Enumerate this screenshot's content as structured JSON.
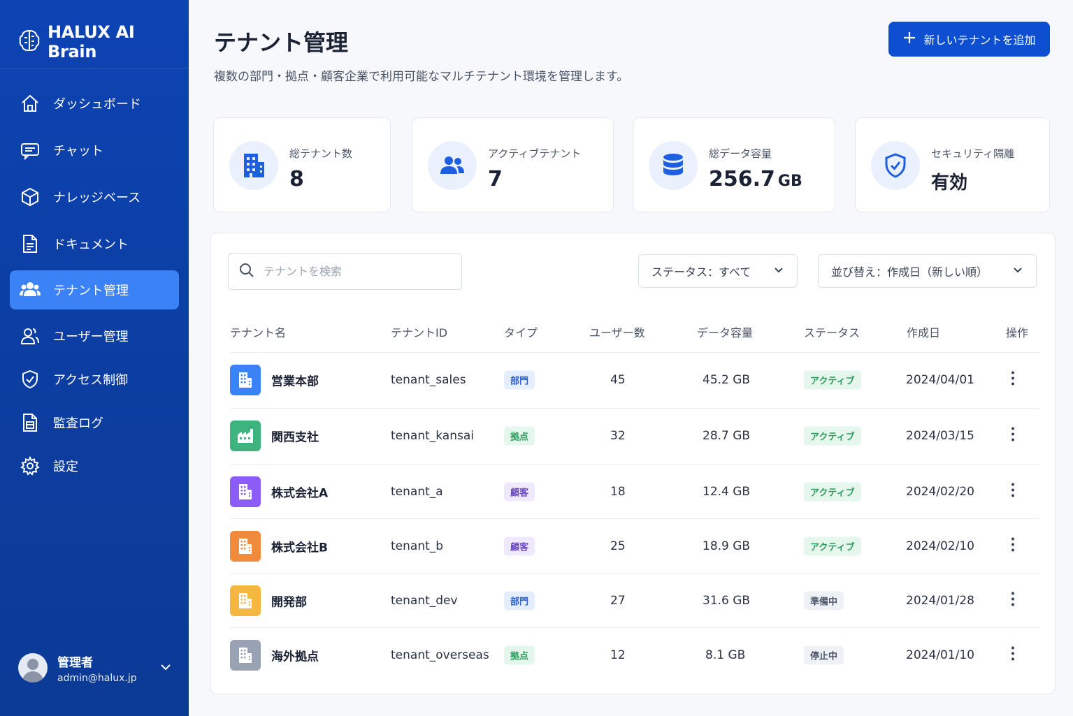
{
  "app": {
    "name": "HALUX AI Brain"
  },
  "sidebar": {
    "items": [
      {
        "label": "ダッシュボード",
        "icon": "home-icon"
      },
      {
        "label": "チャット",
        "icon": "chat-icon"
      },
      {
        "label": "ナレッジベース",
        "icon": "cube-icon"
      },
      {
        "label": "ドキュメント",
        "icon": "document-icon"
      },
      {
        "label": "テナント管理",
        "icon": "users-icon",
        "active": true
      },
      {
        "label": "ユーザー管理",
        "icon": "user-icon"
      },
      {
        "label": "アクセス制御",
        "icon": "shield-icon"
      },
      {
        "label": "監査ログ",
        "icon": "log-icon"
      },
      {
        "label": "設定",
        "icon": "gear-icon"
      }
    ]
  },
  "user": {
    "name": "管理者",
    "email": "admin@halux.jp"
  },
  "header": {
    "title": "テナント管理",
    "subtitle": "複数の部門・拠点・顧客企業で利用可能なマルチテナント環境を管理します。",
    "add_button": "新しいテナントを追加"
  },
  "stats": [
    {
      "label": "総テナント数",
      "value": "8",
      "unit": "",
      "icon": "building-icon"
    },
    {
      "label": "アクティブテナント",
      "value": "7",
      "unit": "",
      "icon": "users-icon"
    },
    {
      "label": "総データ容量",
      "value": "256.7",
      "unit": "GB",
      "icon": "database-icon"
    },
    {
      "label": "セキュリティ隔離",
      "value": "有効",
      "unit": "",
      "icon": "shield-check-icon"
    }
  ],
  "filters": {
    "search_placeholder": "テナントを検索",
    "status": "ステータス：すべて",
    "sort": "並び替え：作成日（新しい順）"
  },
  "table": {
    "columns": [
      "テナント名",
      "テナントID",
      "タイプ",
      "ユーザー数",
      "データ容量",
      "ステータス",
      "作成日",
      "操作"
    ],
    "rows": [
      {
        "name": "営業本部",
        "id": "tenant_sales",
        "type": "部門",
        "users": "45",
        "data": "45.2 GB",
        "status": "アクティブ",
        "created": "2024/04/01"
      },
      {
        "name": "関西支社",
        "id": "tenant_kansai",
        "type": "拠点",
        "users": "32",
        "data": "28.7 GB",
        "status": "アクティブ",
        "created": "2024/03/15"
      },
      {
        "name": "株式会社A",
        "id": "tenant_a",
        "type": "顧客",
        "users": "18",
        "data": "12.4 GB",
        "status": "アクティブ",
        "created": "2024/02/20"
      },
      {
        "name": "株式会社B",
        "id": "tenant_b",
        "type": "顧客",
        "users": "25",
        "data": "18.9 GB",
        "status": "アクティブ",
        "created": "2024/02/10"
      },
      {
        "name": "開発部",
        "id": "tenant_dev",
        "type": "部門",
        "users": "27",
        "data": "31.6 GB",
        "status": "準備中",
        "created": "2024/01/28"
      },
      {
        "name": "海外拠点",
        "id": "tenant_overseas",
        "type": "拠点",
        "users": "12",
        "data": "8.1 GB",
        "status": "停止中",
        "created": "2024/01/10"
      }
    ]
  },
  "colors": {
    "sidebar": "#0d43b3",
    "accent": "#0e4fd1",
    "active_nav": "#3b82f6",
    "tile_blue": "#3b82f6",
    "tile_green": "#3fb37f",
    "tile_purple": "#8b5cf6",
    "tile_orange": "#f08a3c",
    "tile_yellow": "#f4b73f",
    "tile_gray": "#98a2b3"
  }
}
